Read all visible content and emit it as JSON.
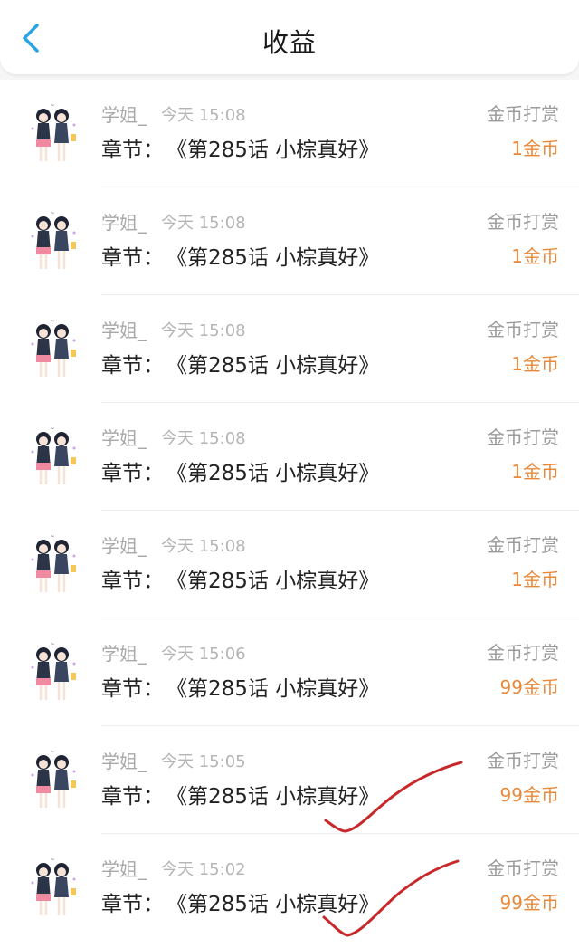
{
  "header": {
    "title": "收益",
    "back_icon": "chevron-left-icon",
    "accent_color": "#2aa3e6"
  },
  "colors": {
    "amount": "#e8893a",
    "annotation_mark": "#c8282a"
  },
  "rows": [
    {
      "name": "学姐_",
      "time": "今天 15:08",
      "chapter_label": "章节：",
      "chapter_title": "《第285话 小棕真好》",
      "type": "金币打赏",
      "amount": "1金币"
    },
    {
      "name": "学姐_",
      "time": "今天 15:08",
      "chapter_label": "章节：",
      "chapter_title": "《第285话 小棕真好》",
      "type": "金币打赏",
      "amount": "1金币"
    },
    {
      "name": "学姐_",
      "time": "今天 15:08",
      "chapter_label": "章节：",
      "chapter_title": "《第285话 小棕真好》",
      "type": "金币打赏",
      "amount": "1金币"
    },
    {
      "name": "学姐_",
      "time": "今天 15:08",
      "chapter_label": "章节：",
      "chapter_title": "《第285话 小棕真好》",
      "type": "金币打赏",
      "amount": "1金币"
    },
    {
      "name": "学姐_",
      "time": "今天 15:08",
      "chapter_label": "章节：",
      "chapter_title": "《第285话 小棕真好》",
      "type": "金币打赏",
      "amount": "1金币"
    },
    {
      "name": "学姐_",
      "time": "今天 15:06",
      "chapter_label": "章节：",
      "chapter_title": "《第285话 小棕真好》",
      "type": "金币打赏",
      "amount": "99金币"
    },
    {
      "name": "学姐_",
      "time": "今天 15:05",
      "chapter_label": "章节：",
      "chapter_title": "《第285话 小棕真好》",
      "type": "金币打赏",
      "amount": "99金币"
    },
    {
      "name": "学姐_",
      "time": "今天 15:02",
      "chapter_label": "章节：",
      "chapter_title": "《第285话 小棕真好》",
      "type": "金币打赏",
      "amount": "99金币"
    }
  ]
}
